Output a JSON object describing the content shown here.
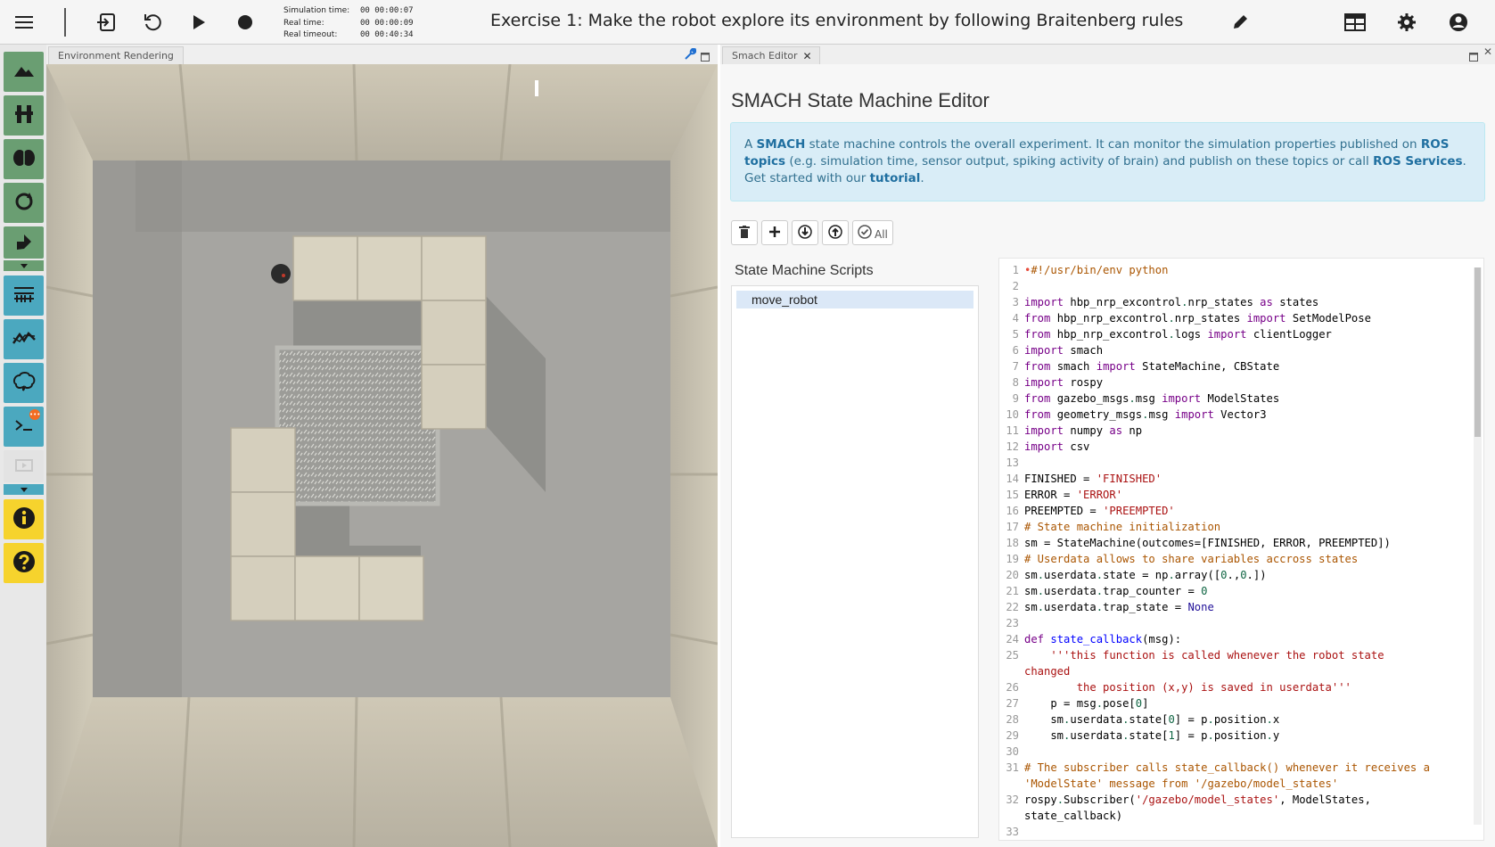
{
  "topbar": {
    "simulation_time_label": "Simulation time:",
    "simulation_time_value": "00 00:00:07",
    "real_time_label": "Real time:",
    "real_time_value": "00 00:00:09",
    "real_timeout_label": "Real timeout:",
    "real_timeout_value": "00 00:40:34",
    "experiment_title": "Exercise 1: Make the robot explore its environment by following Braitenberg rules"
  },
  "env_panel": {
    "tab_label": "Environment Rendering"
  },
  "smach_panel": {
    "tab_label": "Smach Editor",
    "title": "SMACH State Machine Editor",
    "info": {
      "p1": "A ",
      "smach": "SMACH",
      "p2": " state machine controls the overall experiment. It can monitor the simulation properties published on ",
      "ros_topics": "ROS topics",
      "p3": " (e.g. simulation time, sensor output, spiking activity of brain) and publish on these topics or call ",
      "ros_services": "ROS Services",
      "p4": ". Get started with our ",
      "tutorial": "tutorial",
      "p5": "."
    },
    "all_label": "All",
    "scripts_title": "State Machine Scripts",
    "scripts": [
      "move_robot"
    ]
  },
  "code_lines": [
    {
      "n": "1",
      "t": "•#!/usr/bin/env python"
    },
    {
      "n": "2",
      "t": ""
    },
    {
      "n": "3",
      "t": "import hbp_nrp_excontrol.nrp_states as states"
    },
    {
      "n": "4",
      "t": "from hbp_nrp_excontrol.nrp_states import SetModelPose"
    },
    {
      "n": "5",
      "t": "from hbp_nrp_excontrol.logs import clientLogger"
    },
    {
      "n": "6",
      "t": "import smach"
    },
    {
      "n": "7",
      "t": "from smach import StateMachine, CBState"
    },
    {
      "n": "8",
      "t": "import rospy"
    },
    {
      "n": "9",
      "t": "from gazebo_msgs.msg import ModelStates"
    },
    {
      "n": "10",
      "t": "from geometry_msgs.msg import Vector3"
    },
    {
      "n": "11",
      "t": "import numpy as np"
    },
    {
      "n": "12",
      "t": "import csv"
    },
    {
      "n": "13",
      "t": ""
    },
    {
      "n": "14",
      "t": "FINISHED = 'FINISHED'"
    },
    {
      "n": "15",
      "t": "ERROR = 'ERROR'"
    },
    {
      "n": "16",
      "t": "PREEMPTED = 'PREEMPTED'"
    },
    {
      "n": "17",
      "t": "# State machine initialization"
    },
    {
      "n": "18",
      "t": "sm = StateMachine(outcomes=[FINISHED, ERROR, PREEMPTED])"
    },
    {
      "n": "19",
      "t": "# Userdata allows to share variables accross states"
    },
    {
      "n": "20",
      "t": "sm.userdata.state = np.array([0.,0.])"
    },
    {
      "n": "21",
      "t": "sm.userdata.trap_counter = 0"
    },
    {
      "n": "22",
      "t": "sm.userdata.trap_state = None"
    },
    {
      "n": "23",
      "t": ""
    },
    {
      "n": "24",
      "t": "def state_callback(msg):"
    },
    {
      "n": "25",
      "t": "    '''this function is called whenever the robot state"
    },
    {
      "n": "",
      "t": "changed"
    },
    {
      "n": "26",
      "t": "        the position (x,y) is saved in userdata'''"
    },
    {
      "n": "27",
      "t": "    p = msg.pose[0]"
    },
    {
      "n": "28",
      "t": "    sm.userdata.state[0] = p.position.x"
    },
    {
      "n": "29",
      "t": "    sm.userdata.state[1] = p.position.y"
    },
    {
      "n": "30",
      "t": ""
    },
    {
      "n": "31",
      "t": "# The subscriber calls state_callback() whenever it receives a"
    },
    {
      "n": "",
      "t": "'ModelState' message from '/gazebo/model_states'"
    },
    {
      "n": "32",
      "t": "rospy.Subscriber('/gazebo/model_states', ModelStates,"
    },
    {
      "n": "",
      "t": "state_callback)"
    },
    {
      "n": "33",
      "t": ""
    }
  ],
  "colors": {
    "accent_blue": "#4ba8bf",
    "accent_green": "#6a9e72",
    "accent_yellow": "#f6d32d",
    "info_bg": "#d9edf7"
  },
  "icons": {
    "menu": "hamburger-icon",
    "exit": "exit-icon",
    "reset": "reset-icon",
    "play": "play-icon",
    "record": "record-icon",
    "edit": "pencil-icon",
    "layout": "layout-icon",
    "settings": "gear-icon",
    "user": "user-icon"
  }
}
